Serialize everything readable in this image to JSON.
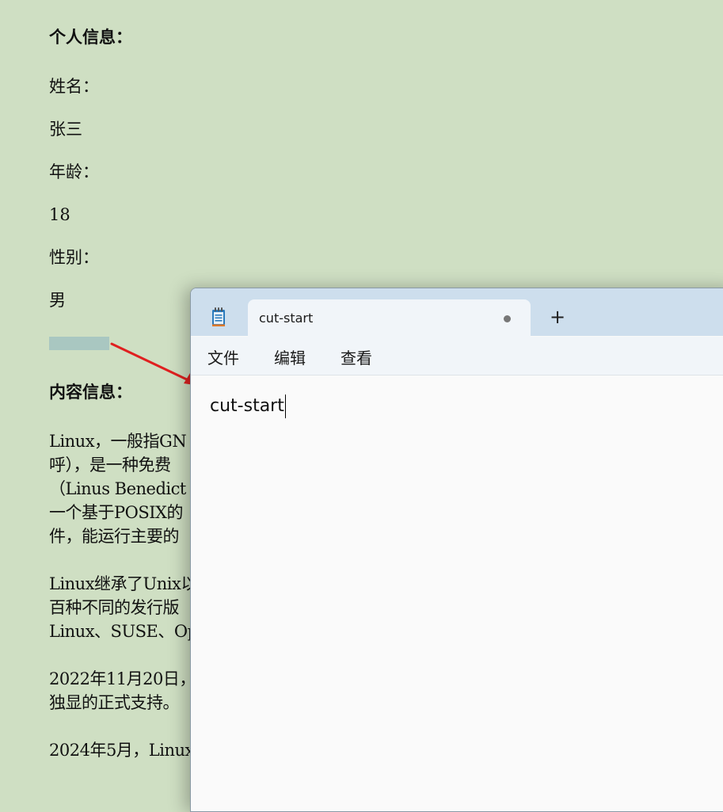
{
  "document": {
    "personal_heading": "个人信息：",
    "name_label": "姓名：",
    "name_value": "张三",
    "age_label": "年龄：",
    "age_value": "18",
    "gender_label": "性别：",
    "gender_value": "男",
    "content_heading": "内容信息：",
    "paragraph1": [
      "Linux，一般指GN",
      "呼），是一种免费",
      "（Linus Benedict To",
      "一个基于POSIX的",
      "件，能运行主要的"
    ],
    "paragraph2": [
      "Linux继承了Unix以",
      "百种不同的发行版",
      "Linux、SUSE、Op"
    ],
    "paragraph3": [
      "2022年11月20日，",
      "独显的正式支持。"
    ],
    "paragraph4": [
      "2024年5月，Linux"
    ]
  },
  "notepad": {
    "tab_title": "cut-start",
    "new_tab": "+",
    "menu": [
      "文件",
      "编辑",
      "查看"
    ],
    "content": "cut-start",
    "icon": "notepad-icon"
  },
  "colors": {
    "page_background": "#cfdfc3",
    "highlight": "#a9c7c1",
    "arrow": "#e02020",
    "titlebar": "#cddeed"
  }
}
